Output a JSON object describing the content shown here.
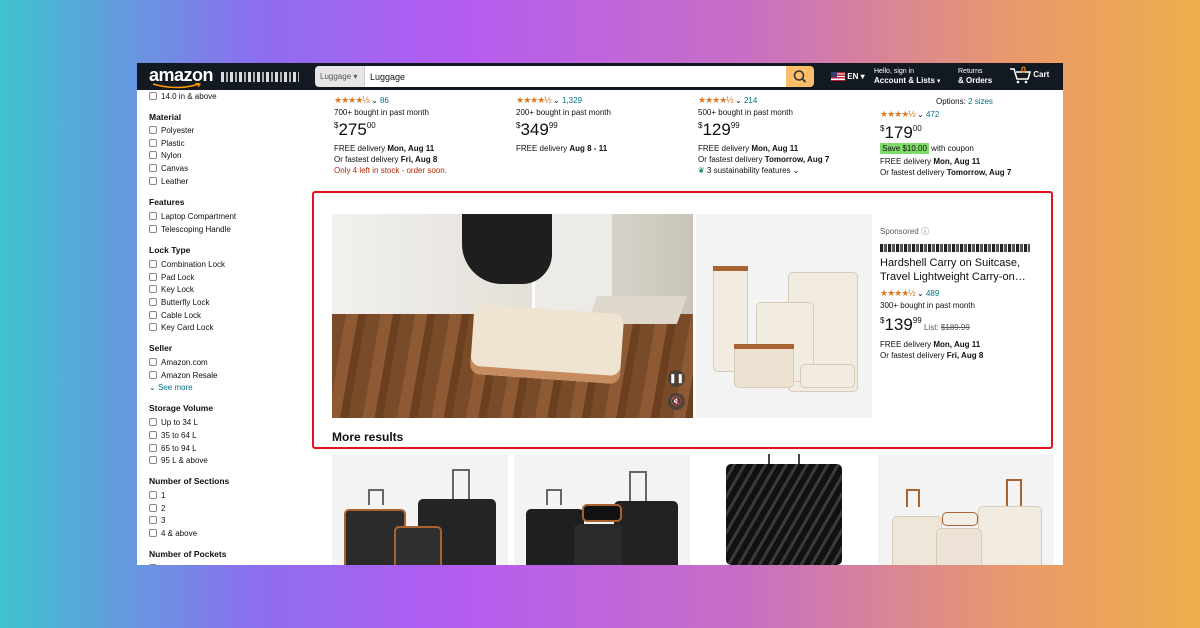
{
  "header": {
    "logo": "amazon",
    "category": "Luggage",
    "search_value": "Luggage",
    "lang": "EN",
    "account_line1": "Hello, sign in",
    "account_line2": "Account & Lists",
    "returns_line1": "Returns",
    "returns_line2": "& Orders",
    "cart_count": "0",
    "cart_label": "Cart"
  },
  "sidebar": {
    "top_item": "14.0 in & above",
    "groups": [
      {
        "title": "Material",
        "items": [
          "Polyester",
          "Plastic",
          "Nylon",
          "Canvas",
          "Leather"
        ]
      },
      {
        "title": "Features",
        "items": [
          "Laptop Compartment",
          "Telescoping Handle"
        ]
      },
      {
        "title": "Lock Type",
        "items": [
          "Combination Lock",
          "Pad Lock",
          "Key Lock",
          "Butterfly Lock",
          "Cable Lock",
          "Key Card Lock"
        ]
      },
      {
        "title": "Seller",
        "items": [
          "Amazon.com",
          "Amazon Resale"
        ],
        "see_more": "See more"
      },
      {
        "title": "Storage Volume",
        "items": [
          "Up to 34 L",
          "35 to 64 L",
          "65 to 94 L",
          "95 L & above"
        ]
      },
      {
        "title": "Number of Sections",
        "items": [
          "1",
          "2",
          "3",
          "4 & above"
        ]
      },
      {
        "title": "Number of Pockets",
        "items": []
      }
    ]
  },
  "products": [
    {
      "rating": 4.5,
      "reviews": "86",
      "bought": "700+ bought in past month",
      "price_whole": "275",
      "price_frac": "00",
      "delivery1": "FREE delivery ",
      "delivery1_date": "Mon, Aug 11",
      "delivery2": "Or fastest delivery ",
      "delivery2_date": "Fri, Aug 8",
      "note": "Only 4 left in stock - order soon."
    },
    {
      "rating": 4.5,
      "reviews": "1,329",
      "bought": "200+ bought in past month",
      "price_whole": "349",
      "price_frac": "99",
      "delivery1": "FREE delivery ",
      "delivery1_date": "Aug 8 - 11",
      "delivery2": "",
      "delivery2_date": "",
      "note": ""
    },
    {
      "rating": 4.5,
      "reviews": "214",
      "bought": "500+ bought in past month",
      "price_whole": "129",
      "price_frac": "99",
      "delivery1": "FREE delivery ",
      "delivery1_date": "Mon, Aug 11",
      "delivery2": "Or fastest delivery ",
      "delivery2_date": "Tomorrow, Aug 7",
      "note": "3 sustainability features"
    },
    {
      "options_label": "Options: ",
      "options_link": "2 sizes",
      "rating": 4.5,
      "reviews": "472",
      "price_whole": "179",
      "price_frac": "00",
      "coupon": "Save $10.00",
      "coupon_suffix": " with coupon",
      "delivery1": "FREE delivery ",
      "delivery1_date": "Mon, Aug 11",
      "delivery2": "Or fastest delivery ",
      "delivery2_date": "Tomorrow, Aug 7"
    }
  ],
  "ad": {
    "sponsored": "Sponsored",
    "title": "Hardshell Carry on Suitcase, Travel Lightweight Carry-on…",
    "rating": 4.5,
    "reviews": "489",
    "bought": "300+ bought in past month",
    "price_whole": "139",
    "price_frac": "99",
    "list_label": "List: ",
    "list_price": "$189.99",
    "delivery1": "FREE delivery ",
    "delivery1_date": "Mon, Aug 11",
    "delivery2": "Or fastest delivery ",
    "delivery2_date": "Fri, Aug 8"
  },
  "more_results": "More results",
  "currency": "$",
  "colors": {
    "header_bg": "#131921",
    "search_button": "#febd69",
    "star": "#de7921",
    "link": "#007185",
    "ad_border": "#e3141e",
    "coupon": "#7fda69"
  }
}
